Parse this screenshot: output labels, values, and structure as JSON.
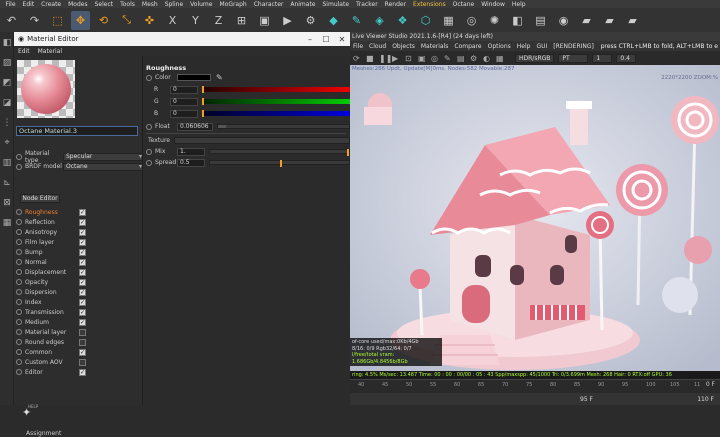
{
  "menubar": [
    "File",
    "Edit",
    "Create",
    "Modes",
    "Select",
    "Tools",
    "Mesh",
    "Spline",
    "Volume",
    "MoGraph",
    "Character",
    "Animate",
    "Simulate",
    "Tracker",
    "Render",
    "Extensions",
    "Octane",
    "Window",
    "Help"
  ],
  "material_editor": {
    "title": "Material Editor",
    "menu": [
      "Edit",
      "Material"
    ],
    "material_name": "Octane Material.3",
    "material_type_label": "Material type",
    "material_type_value": "Specular",
    "brdf_label": "BRDF model",
    "brdf_value": "Octane",
    "node_editor_label": "Node Editor",
    "channels": [
      {
        "name": "Roughness",
        "checked": true,
        "active": true
      },
      {
        "name": "Reflection",
        "checked": true
      },
      {
        "name": "Anisotropy",
        "checked": true
      },
      {
        "name": "Film layer",
        "checked": true
      },
      {
        "name": "Bump",
        "checked": true
      },
      {
        "name": "Normal",
        "checked": true
      },
      {
        "name": "Displacement",
        "checked": true
      },
      {
        "name": "Opacity",
        "checked": true
      },
      {
        "name": "Dispersion",
        "checked": true
      },
      {
        "name": "Index",
        "checked": true
      },
      {
        "name": "Transmission",
        "checked": true
      },
      {
        "name": "Medium",
        "checked": true
      },
      {
        "name": "Material layer",
        "checked": false
      },
      {
        "name": "Round edges",
        "checked": false
      },
      {
        "name": "Common",
        "checked": true
      },
      {
        "name": "Custom AOV",
        "checked": false
      },
      {
        "name": "Editor",
        "checked": true
      }
    ],
    "help_label": "HELP",
    "assignment_label": "Assignment",
    "section_title": "Roughness",
    "color_label": "Color",
    "r_label": "R",
    "r_value": "0",
    "g_label": "G",
    "g_value": "0",
    "b_label": "B",
    "b_value": "0",
    "float_label": "Float",
    "float_value": "0.060606",
    "float_fraction": 0.06,
    "texture_label": "Texture",
    "mix_label": "Mix",
    "mix_value": "1.",
    "spread_label": "Spread",
    "spread_value": "0.5"
  },
  "viewer": {
    "title": "Live Viewer Studio 2021.1.6-[R4] (24 days left)",
    "menu": [
      "File",
      "Cloud",
      "Objects",
      "Materials",
      "Compare",
      "Options",
      "Help",
      "GUI",
      "[RENDERING]"
    ],
    "hint": "press CTRL+LMB to fold, ALT+LMB to e",
    "color_space": "HDR/sRGB",
    "tonemap": "PT",
    "num1": "1",
    "num2": "0.4",
    "stats_top": "Meshes:286 Updt, Update[M]0ms. Nodes:582 Movable:287",
    "stats_tr": "2220*2200 ZOOM:%",
    "info_lines": [
      "of-core used/max:0Kb/4Gb",
      "8/16: 0/9             Rgb32/64: 0/7",
      "l/free/total vram: 1.686Gb/4.8456b/8Gb"
    ],
    "status": "ring: 4.5%  Ms/sec: 13.487   Time: 00 : 00 : 00/00 : 05 : 43   Spp/maxspp: 45/1000   Tri: 0/3.699m   Mesh: 268   Hair: 0   RTX:off   GPU: 36",
    "ticks": [
      "40",
      "45",
      "50",
      "55",
      "60",
      "65",
      "70",
      "75",
      "80",
      "85",
      "90",
      "95",
      "100",
      "105",
      "11"
    ],
    "frame_right": "0 F",
    "frame_bottom": "95 F",
    "frame_bottom_right": "110 F"
  }
}
